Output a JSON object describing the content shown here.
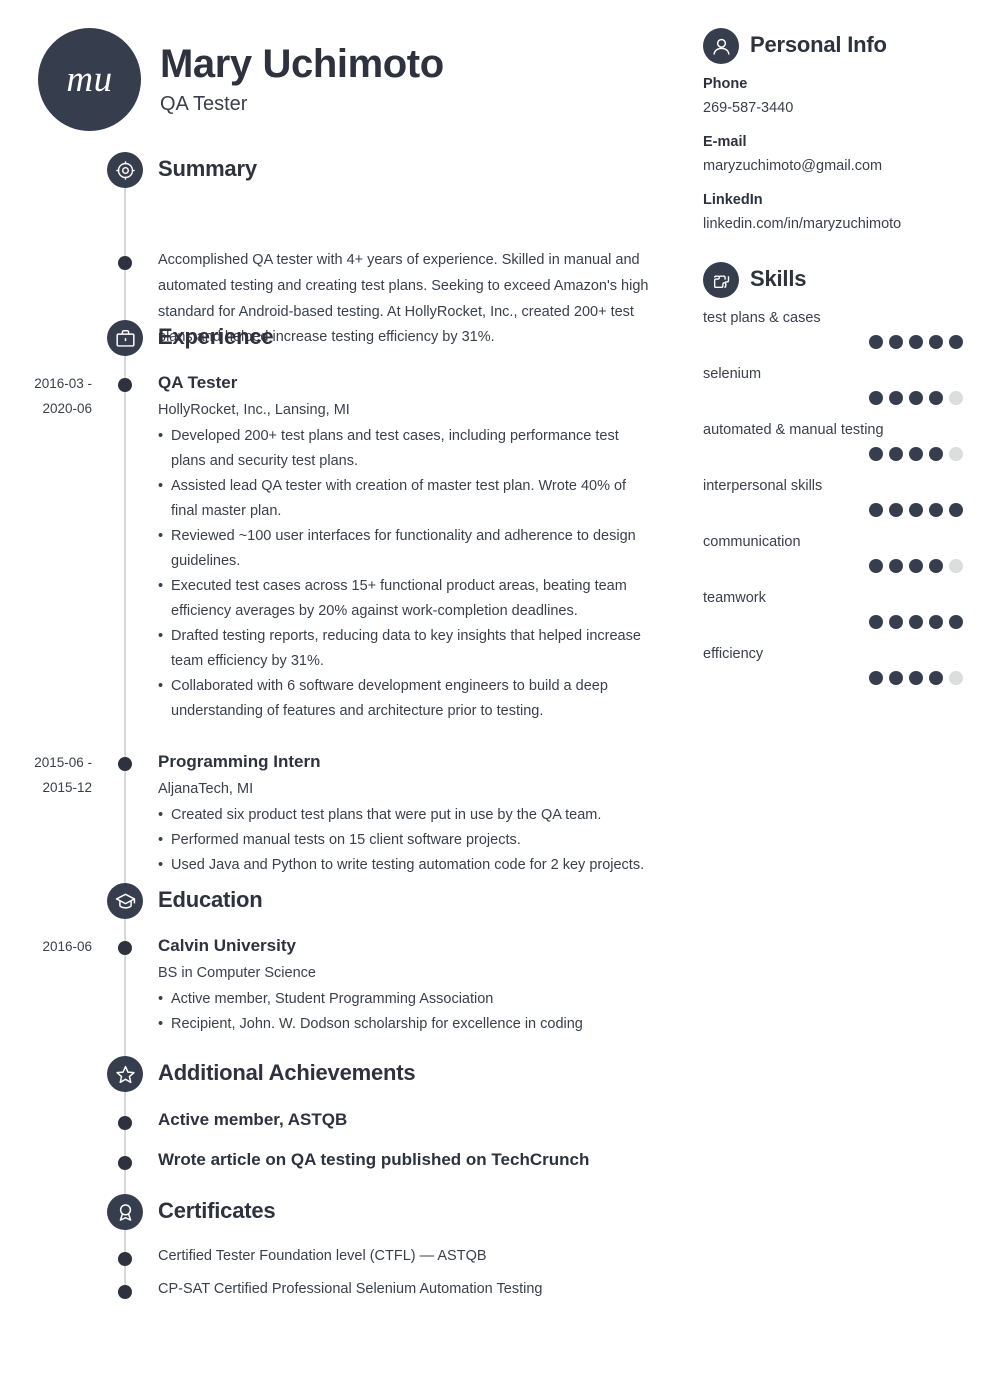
{
  "header": {
    "avatar_initials": "mu",
    "name": "Mary Uchimoto",
    "job_title": "QA Tester"
  },
  "colors": {
    "dark": "#363d4d",
    "text": "#3a3f4b",
    "heading": "#2d323e",
    "rule": "#d7d8da",
    "dot_off": "#dcdddf"
  },
  "sections": {
    "summary": {
      "title": "Summary",
      "icon": "target-icon",
      "text": "Accomplished QA tester with 4+ years of experience. Skilled in manual and automated testing and creating test plans. Seeking to exceed Amazon's high standard for Android-based testing. At HollyRocket, Inc., created 200+ test plans and helped increase testing efficiency by 31%."
    },
    "experience": {
      "title": "Experience",
      "icon": "briefcase-icon",
      "entries": [
        {
          "date": "2016-03 - 2020-06",
          "date_line1": "2016-03 -",
          "date_line2": "2020-06",
          "role": "QA Tester",
          "org": "HollyRocket, Inc., Lansing, MI",
          "bullets": [
            "Developed 200+ test plans and test cases, including performance test plans and security test plans.",
            "Assisted lead QA tester with creation of master test plan. Wrote 40% of final master plan.",
            "Reviewed ~100 user interfaces for functionality and adherence to design guidelines.",
            "Executed test cases across 15+ functional product areas, beating team efficiency averages by 20% against work-completion deadlines.",
            "Drafted testing reports, reducing data to key insights that helped increase team efficiency by 31%.",
            "Collaborated with 6 software development engineers to build a deep understanding of features and architecture prior to testing."
          ]
        },
        {
          "date": "2015-06 - 2015-12",
          "date_line1": "2015-06 -",
          "date_line2": "2015-12",
          "role": "Programming Intern",
          "org": "AljanaTech, MI",
          "bullets": [
            "Created six product test plans that were put in use by the QA team.",
            "Performed manual tests on 15 client software projects.",
            "Used Java and Python to write testing automation code for 2 key projects."
          ]
        }
      ]
    },
    "education": {
      "title": "Education",
      "icon": "graduation-cap-icon",
      "entries": [
        {
          "date": "2016-06",
          "date_line1": "2016-06",
          "date_line2": "",
          "role": "Calvin University",
          "org": "BS in Computer Science",
          "bullets": [
            "Active member, Student Programming Association",
            "Recipient, John. W. Dodson scholarship for excellence in coding"
          ]
        }
      ]
    },
    "achievements": {
      "title": "Additional Achievements",
      "icon": "star-icon",
      "items": [
        "Active member, ASTQB",
        "Wrote article on QA testing published on TechCrunch"
      ]
    },
    "certificates": {
      "title": "Certificates",
      "icon": "award-ribbon-icon",
      "items": [
        "Certified Tester Foundation level (CTFL) — ASTQB",
        "CP-SAT Certified Professional Selenium Automation Testing"
      ]
    }
  },
  "sidebar": {
    "personal_info": {
      "title": "Personal Info",
      "icon": "person-icon",
      "fields": [
        {
          "label": "Phone",
          "value": "269-587-3440"
        },
        {
          "label": "E-mail",
          "value": "maryzuchimoto@gmail.com"
        },
        {
          "label": "LinkedIn",
          "value": "linkedin.com/in/maryzuchimoto"
        }
      ]
    },
    "skills": {
      "title": "Skills",
      "icon": "puzzle-icon",
      "max_rating": 5,
      "items": [
        {
          "name": "test plans & cases",
          "rating": 5
        },
        {
          "name": "selenium",
          "rating": 4
        },
        {
          "name": "automated & manual testing",
          "rating": 4
        },
        {
          "name": "interpersonal skills",
          "rating": 5
        },
        {
          "name": "communication",
          "rating": 4
        },
        {
          "name": "teamwork",
          "rating": 5
        },
        {
          "name": "efficiency",
          "rating": 4
        }
      ]
    }
  }
}
